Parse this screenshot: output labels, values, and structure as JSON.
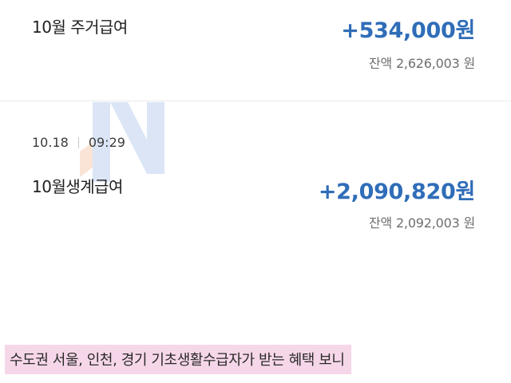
{
  "transactions": [
    {
      "description": "10월 주거급여",
      "amount": "+534,000원",
      "balance": "잔액 2,626,003 원"
    },
    {
      "date": "10.18",
      "time": "09:29",
      "description": "10월생계급여",
      "amount": "+2,090,820원",
      "balance": "잔액 2,092,003 원"
    }
  ],
  "caption": "수도권 서울, 인천, 경기 기초생활수급자가 받는 혜택 보니",
  "colors": {
    "amount": "#2f6db8",
    "caption_highlight": "#f6d7e9",
    "watermark_blue": "#7fa6e0",
    "watermark_orange": "#f0a070"
  },
  "watermark_icon": "n-logo-watermark"
}
